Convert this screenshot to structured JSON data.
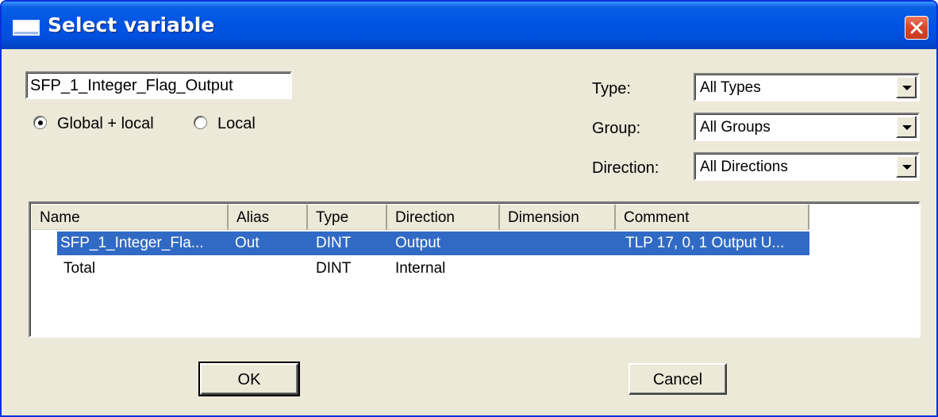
{
  "window": {
    "title": "Select variable"
  },
  "search": {
    "value": "SFP_1_Integer_Flag_Output"
  },
  "scope": {
    "options": [
      {
        "label": "Global + local",
        "selected": true
      },
      {
        "label": "Local",
        "selected": false
      }
    ]
  },
  "filters": {
    "type": {
      "label": "Type:",
      "value": "All Types"
    },
    "group": {
      "label": "Group:",
      "value": "All Groups"
    },
    "direction": {
      "label": "Direction:",
      "value": "All Directions"
    }
  },
  "table": {
    "columns": [
      "Name",
      "Alias",
      "Type",
      "Direction",
      "Dimension",
      "Comment"
    ],
    "rows": [
      {
        "name": "SFP_1_Integer_Fla...",
        "alias": "Out",
        "type": "DINT",
        "direction": "Output",
        "dimension": "",
        "comment": "TLP 17, 0, 1 Output U...",
        "selected": true
      },
      {
        "name": "Total",
        "alias": "",
        "type": "DINT",
        "direction": "Internal",
        "dimension": "",
        "comment": "",
        "selected": false
      }
    ]
  },
  "buttons": {
    "ok": "OK",
    "cancel": "Cancel"
  },
  "colors": {
    "selection": "#316ac5",
    "titlebar": "#0054e3",
    "dialog": "#ece9d8"
  },
  "icons": {
    "title": "window-icon",
    "close": "close-icon"
  }
}
